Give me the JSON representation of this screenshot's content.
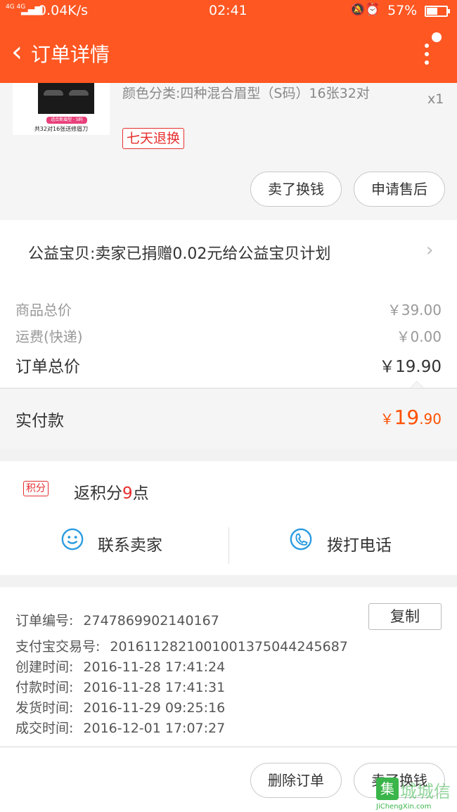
{
  "status_bar": {
    "network": "4G 4G",
    "speed": "0.04K/s",
    "time": "02:41",
    "icons": "bell-off-icon alarm-icon",
    "battery": "57%",
    "battery_level": 0.57
  },
  "nav": {
    "back_icon": "chevron-left-icon",
    "title": "订单详情",
    "more_icon": "more-vertical-icon"
  },
  "product": {
    "spec": "颜色分类:四种混合眉型（S码）16张32对",
    "quantity": "x1",
    "return_badge": "七天退换",
    "image_caption": "共32对16张送修眉刀",
    "image_tag": "适合新眉型 · S码",
    "buttons": {
      "sell": "卖了换钱",
      "after_sale": "申请售后"
    }
  },
  "charity": {
    "text": "公益宝贝:卖家已捐赠0.02元给公益宝贝计划",
    "arrow_icon": "chevron-right-icon"
  },
  "prices": {
    "goods_total_label": "商品总价",
    "goods_total": "￥39.00",
    "shipping_label": "运费(快递)",
    "shipping": "￥0.00",
    "order_total_label": "订单总价",
    "order_total": "￥19.90"
  },
  "paid": {
    "label": "实付款",
    "currency": "￥",
    "integer": "19",
    "decimal": ".90"
  },
  "points": {
    "tag": "积分",
    "text_before": "返积分",
    "value": "9",
    "text_after": "点"
  },
  "contact": {
    "seller": "联系卖家",
    "phone": "拨打电话",
    "seller_icon": "smile-chat-icon",
    "phone_icon": "phone-icon"
  },
  "order_info": {
    "copy_button": "复制",
    "rows": [
      {
        "key": "订单编号:",
        "value": "2747869902140167"
      },
      {
        "key": "支付宝交易号:",
        "value": "2016112821001001375044245687"
      },
      {
        "key": "创建时间:",
        "value": "2016-11-28 17:41:24"
      },
      {
        "key": "付款时间:",
        "value": "2016-11-28 17:41:31"
      },
      {
        "key": "发货时间:",
        "value": "2016-11-29 09:25:16"
      },
      {
        "key": "成交时间:",
        "value": "2016-12-01 17:07:27"
      }
    ]
  },
  "bottom": {
    "delete": "删除订单",
    "sell": "卖了换钱"
  },
  "watermark": {
    "glyph": "集",
    "big": "城城信",
    "small": "JiChengXin.com"
  },
  "colors": {
    "brand": "#fe5722",
    "price_red": "#ff5000",
    "badge_red": "#e62e2e",
    "icon_blue": "#2a9be0"
  }
}
